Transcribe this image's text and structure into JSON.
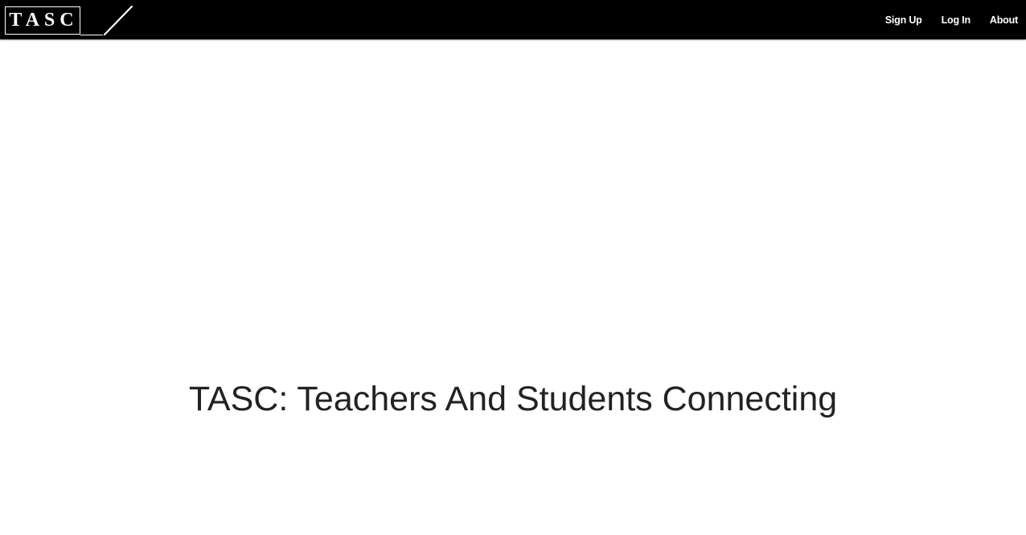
{
  "navbar": {
    "logo_text": "TASC",
    "links": [
      {
        "label": "Sign Up"
      },
      {
        "label": "Log In"
      },
      {
        "label": "About"
      }
    ]
  },
  "main": {
    "title": "TASC: Teachers And Students Connecting"
  },
  "colors": {
    "navbar_background": "#000000",
    "navbar_text": "#ffffff",
    "page_background": "#ffffff",
    "title_text": "#222222"
  }
}
